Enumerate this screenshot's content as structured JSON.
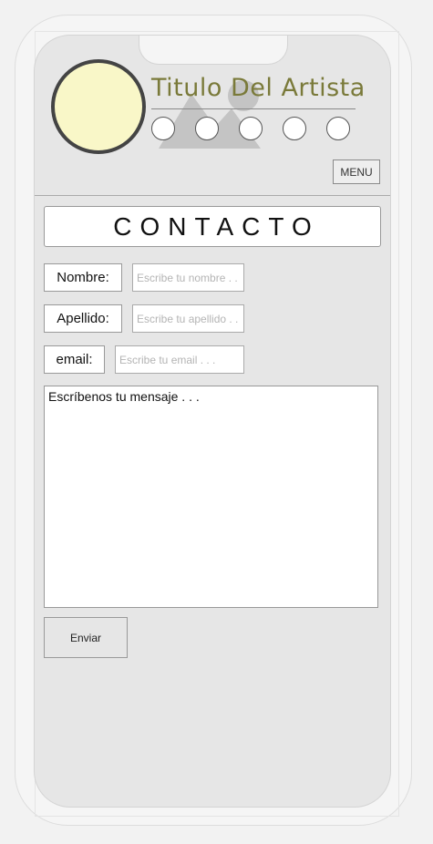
{
  "header": {
    "artist_title": "Titulo Del Artista",
    "social_links": [
      {
        "icon": "social-link-icon"
      },
      {
        "icon": "social-link-icon"
      },
      {
        "icon": "social-link-icon"
      },
      {
        "icon": "social-link-icon"
      },
      {
        "icon": "social-link-icon"
      }
    ],
    "menu_label": "MENU"
  },
  "contact": {
    "title": "CONTACTO",
    "fields": {
      "nombre": {
        "label": "Nombre:",
        "placeholder": "Escribe tu nombre . . ."
      },
      "apellido": {
        "label": "Apellido:",
        "placeholder": "Escribe tu apellido . . ."
      },
      "email": {
        "label": "email:",
        "placeholder": "Escribe tu email . . ."
      }
    },
    "message_placeholder": "Escríbenos tu mensaje . . .",
    "submit_label": "Enviar"
  },
  "colors": {
    "logo_fill": "#f9f7c8",
    "logo_border": "#444444",
    "title_color": "#7a7a3a",
    "screen_background": "#e6e6e6"
  }
}
